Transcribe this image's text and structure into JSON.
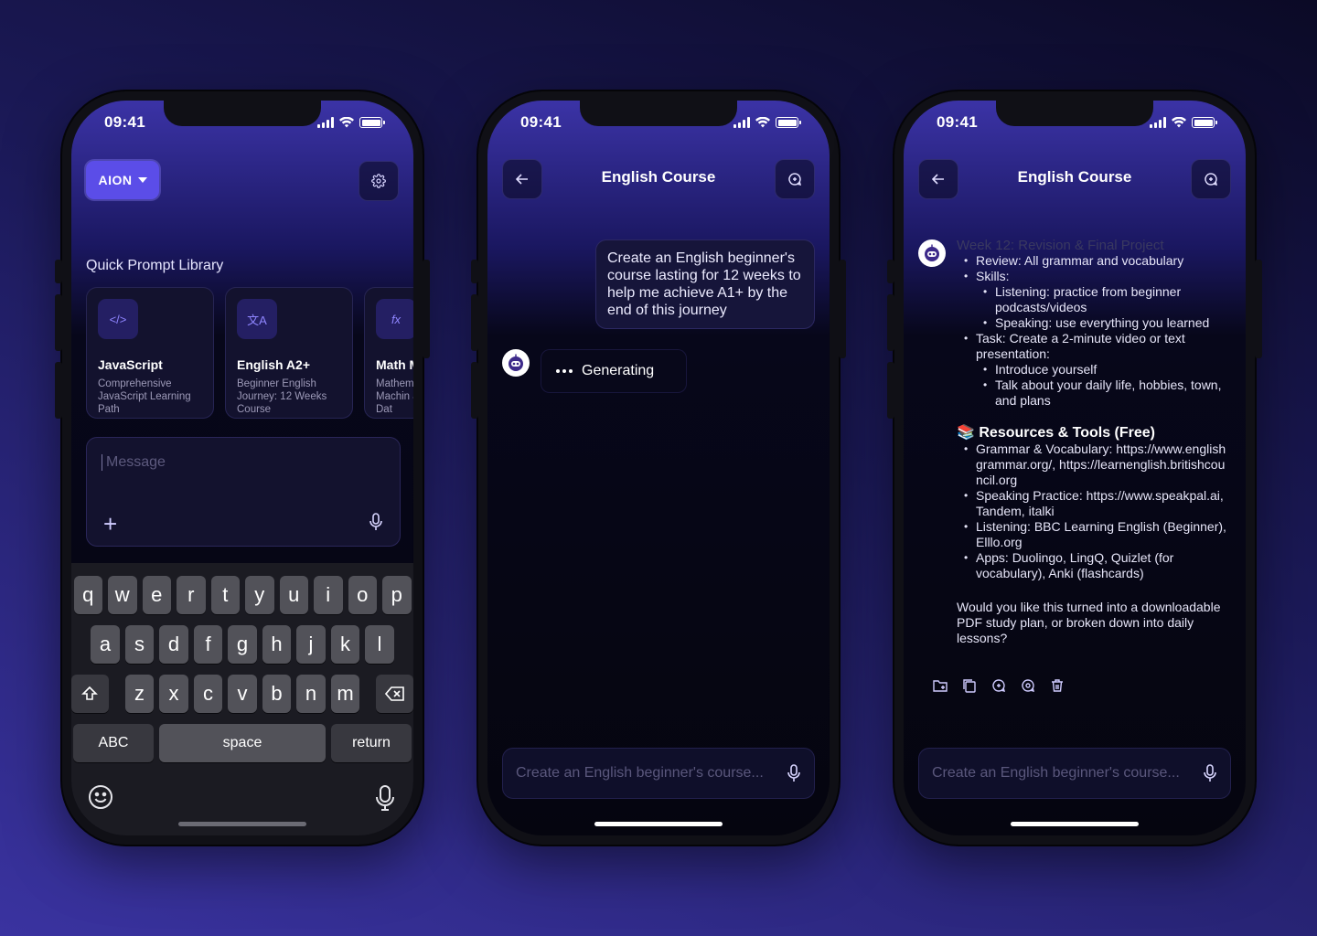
{
  "phone1": {
    "time": "09:41",
    "brand_label": "AION",
    "section_title": "Quick Prompt Library",
    "cards": [
      {
        "icon": "code-icon",
        "title": "JavaScript",
        "subtitle": "Comprehensive JavaScript Learning Path"
      },
      {
        "icon": "translate-icon",
        "title": "English A2+",
        "subtitle": "Beginner English Journey: 12 Weeks Course"
      },
      {
        "icon": "function-icon",
        "title": "Math M",
        "subtitle": "Mathem Machin and Dat"
      }
    ],
    "message_placeholder": "Message",
    "keyboard": {
      "row1": [
        "q",
        "w",
        "e",
        "r",
        "t",
        "y",
        "u",
        "i",
        "o",
        "p"
      ],
      "row2": [
        "a",
        "s",
        "d",
        "f",
        "g",
        "h",
        "j",
        "k",
        "l"
      ],
      "row3": [
        "z",
        "x",
        "c",
        "v",
        "b",
        "n",
        "m"
      ],
      "abc": "ABC",
      "space": "space",
      "return": "return"
    }
  },
  "phone2": {
    "time": "09:41",
    "title": "English Course",
    "user_message": "Create an English beginner's course lasting for 12 weeks to help me achieve A1+ by the end of this journey",
    "status": "Generating",
    "input_placeholder": "Create an English beginner's course..."
  },
  "phone3": {
    "time": "09:41",
    "title": "English Course",
    "faded_heading": "Week 12: Revision & Final Project",
    "week_items": {
      "review": "Review: All grammar and vocabulary",
      "skills": "Skills:",
      "listening": "Listening: practice from beginner podcasts/videos",
      "speaking": "Speaking: use everything you learned",
      "task": "Task: Create a 2-minute video or text presentation:",
      "introduce": "Introduce yourself",
      "talk": "Talk about your daily life, hobbies, town, and plans"
    },
    "resources_heading": "📚 Resources & Tools (Free)",
    "resources": [
      "Grammar & Vocabulary: https://www.englishgrammar.org/, https://learnenglish.britishcouncil.org",
      "Speaking Practice: https://www.speakpal.ai, Tandem, italki",
      "Listening: BBC Learning English (Beginner), Elllo.org",
      "Apps: Duolingo, LingQ, Quizlet (for vocabulary), Anki (flashcards)"
    ],
    "closing_question": "Would you like this turned into a downloadable PDF study plan, or broken down into daily lessons?",
    "action_icons": [
      "folder-add-icon",
      "copy-icon",
      "regenerate-icon",
      "search-chat-icon",
      "trash-icon"
    ],
    "input_placeholder": "Create an English beginner's course..."
  },
  "colors": {
    "accent": "#5b4de8",
    "background_top": "#0b0a26",
    "background_bottom": "#3a33a0"
  }
}
